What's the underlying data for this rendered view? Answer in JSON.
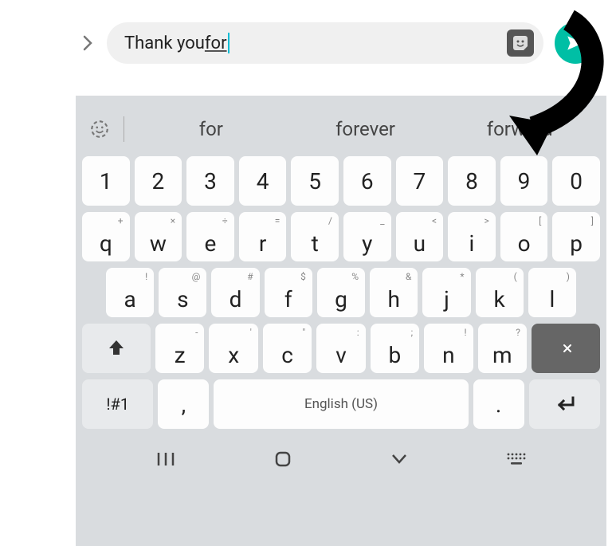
{
  "input": {
    "prefix": "Thank you ",
    "active_word": "for"
  },
  "suggestions": {
    "s1": "for",
    "s2": "forever",
    "s3": "forward"
  },
  "row_num": {
    "k0": "1",
    "k1": "2",
    "k2": "3",
    "k3": "4",
    "k4": "5",
    "k5": "6",
    "k6": "7",
    "k7": "8",
    "k8": "9",
    "k9": "0"
  },
  "row2": {
    "k0": {
      "m": "q",
      "s": "+"
    },
    "k1": {
      "m": "w",
      "s": "×"
    },
    "k2": {
      "m": "e",
      "s": "÷"
    },
    "k3": {
      "m": "r",
      "s": "="
    },
    "k4": {
      "m": "t",
      "s": "/"
    },
    "k5": {
      "m": "y",
      "s": "_"
    },
    "k6": {
      "m": "u",
      "s": "<"
    },
    "k7": {
      "m": "i",
      "s": ">"
    },
    "k8": {
      "m": "o",
      "s": "["
    },
    "k9": {
      "m": "p",
      "s": "]"
    }
  },
  "row3": {
    "k0": {
      "m": "a",
      "s": "!"
    },
    "k1": {
      "m": "s",
      "s": "@"
    },
    "k2": {
      "m": "d",
      "s": "#"
    },
    "k3": {
      "m": "f",
      "s": "$"
    },
    "k4": {
      "m": "g",
      "s": "%"
    },
    "k5": {
      "m": "h",
      "s": "&"
    },
    "k6": {
      "m": "j",
      "s": "*"
    },
    "k7": {
      "m": "k",
      "s": "("
    },
    "k8": {
      "m": "l",
      "s": ")"
    }
  },
  "row4": {
    "k0": {
      "m": "z",
      "s": "-"
    },
    "k1": {
      "m": "x",
      "s": "'"
    },
    "k2": {
      "m": "c",
      "s": "\""
    },
    "k3": {
      "m": "v",
      "s": ":"
    },
    "k4": {
      "m": "b",
      "s": ";"
    },
    "k5": {
      "m": "n",
      "s": "!"
    },
    "k6": {
      "m": "m",
      "s": "?"
    }
  },
  "bottom": {
    "sym": "!#1",
    "comma": ",",
    "space": "English (US)",
    "period": "."
  },
  "colors": {
    "accent": "#00bfa5",
    "caret": "#00bcd4"
  }
}
